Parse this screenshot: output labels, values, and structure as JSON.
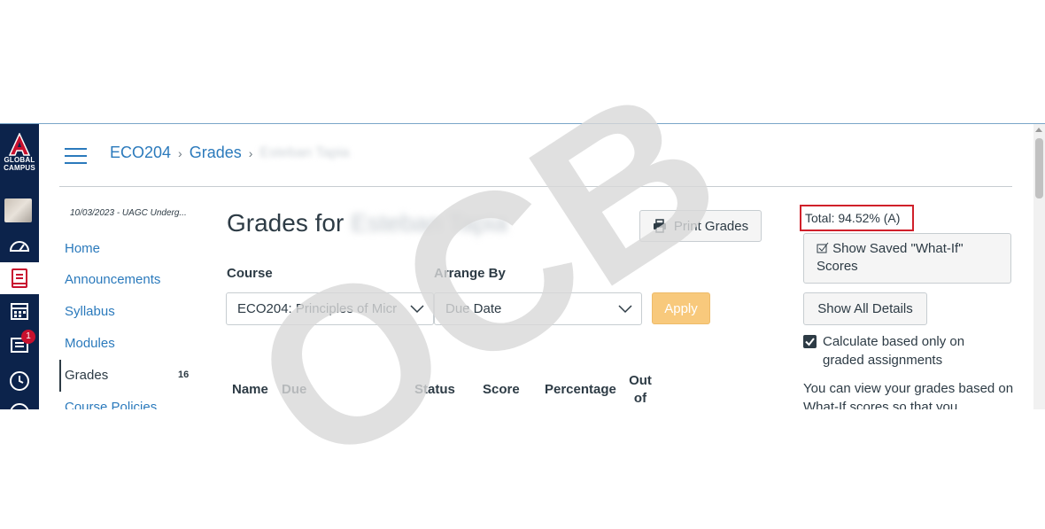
{
  "global_nav": {
    "logo_text": "GLOBAL CAMPUS",
    "inbox_badge": "1"
  },
  "breadcrumb": {
    "course": "ECO204",
    "section": "Grades",
    "student": "Esteban Tapia"
  },
  "course_nav": {
    "term": "10/03/2023 - UAGC Underg...",
    "items": [
      "Home",
      "Announcements",
      "Syllabus",
      "Modules",
      "Grades",
      "Course Policies"
    ],
    "grades_count": "16"
  },
  "main": {
    "title_prefix": "Grades for",
    "title_student": "Esteban Tapia",
    "print_label": "Print Grades",
    "course_label": "Course",
    "course_value": "ECO204: Principles of Micr",
    "arrange_label": "Arrange By",
    "arrange_value": "Due Date",
    "apply_label": "Apply",
    "columns": [
      "Name",
      "Due",
      "Status",
      "Score",
      "Percentage",
      "Out of"
    ]
  },
  "sidebar": {
    "total": "Total: 94.52% (A)",
    "whatif_label": "Show Saved \"What-If\" Scores",
    "details_label": "Show All Details",
    "calc_label": "Calculate based only on graded assignments",
    "view_text": "You can view your grades based on What-If scores so that you"
  },
  "watermark": "OCB",
  "colors": {
    "nav_bg": "#0c234b",
    "link": "#2b7abc",
    "apply_bg": "#f8c97c",
    "total_border": "#d0202a"
  }
}
